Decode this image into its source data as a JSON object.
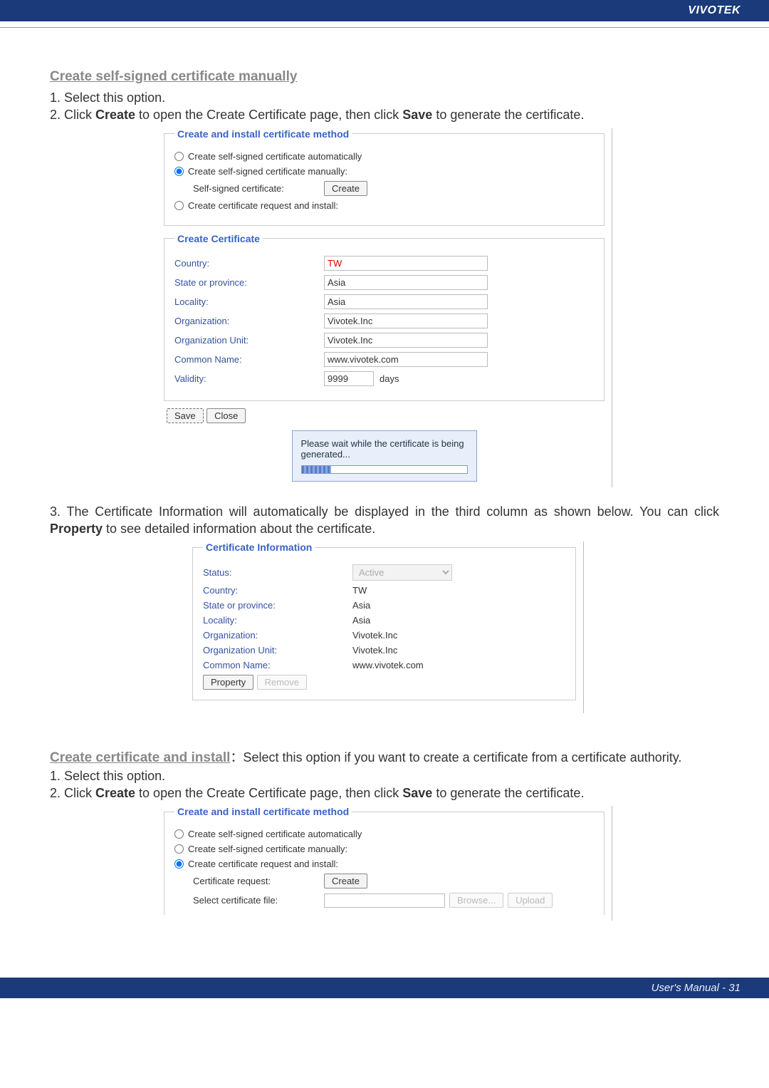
{
  "header": {
    "brand": "VIVOTEK"
  },
  "section1": {
    "heading": "Create self-signed certificate manually",
    "step1": "1. Select this option.",
    "step2_pre": "2. Click ",
    "step2_b1": "Create",
    "step2_mid": " to open the Create Certificate page, then click ",
    "step2_b2": "Save",
    "step2_post": " to generate the certificate."
  },
  "sshot1": {
    "legend": "Create and install certificate method",
    "radio_auto": "Create self-signed certificate automatically",
    "radio_manual": "Create self-signed certificate manually:",
    "self_signed_label": "Self-signed certificate:",
    "create_btn": "Create",
    "radio_request": "Create certificate request and install:",
    "cc_legend": "Create Certificate",
    "fields": {
      "country": {
        "label": "Country:",
        "value": "TW"
      },
      "state": {
        "label": "State or province:",
        "value": "Asia"
      },
      "locality": {
        "label": "Locality:",
        "value": "Asia"
      },
      "org": {
        "label": "Organization:",
        "value": "Vivotek.Inc"
      },
      "ou": {
        "label": "Organization Unit:",
        "value": "Vivotek.Inc"
      },
      "cn": {
        "label": "Common Name:",
        "value": "www.vivotek.com"
      },
      "validity": {
        "label": "Validity:",
        "value": "9999",
        "unit": "days"
      }
    },
    "save_btn": "Save",
    "close_btn": "Close",
    "toast": "Please wait while the certificate is being generated..."
  },
  "section1b": {
    "para_pre": "3. The Certificate Information will automatically be displayed in the third column as shown below. You can click ",
    "para_b": "Property",
    "para_post": " to see detailed information about the certificate."
  },
  "sshot2": {
    "legend": "Certificate Information",
    "status_label": "Status:",
    "status_value": "Active",
    "rows": {
      "country": {
        "label": "Country:",
        "value": "TW"
      },
      "state": {
        "label": "State or province:",
        "value": "Asia"
      },
      "locality": {
        "label": "Locality:",
        "value": "Asia"
      },
      "org": {
        "label": "Organization:",
        "value": "Vivotek.Inc"
      },
      "ou": {
        "label": "Organization Unit:",
        "value": "Vivotek.Inc"
      },
      "cn": {
        "label": "Common Name:",
        "value": "www.vivotek.com"
      }
    },
    "property_btn": "Property",
    "remove_btn": "Remove"
  },
  "section2": {
    "heading": "Create certificate and install",
    "desc": "：Select this option if you want to create a certificate from a certificate authority.",
    "step1": "1. Select this option.",
    "step2_pre": "2. Click ",
    "step2_b1": "Create",
    "step2_mid": " to open the Create Certificate page, then click ",
    "step2_b2": "Save",
    "step2_post": " to generate the certificate."
  },
  "sshot3": {
    "legend": "Create and install certificate method",
    "radio_auto": "Create self-signed certificate automatically",
    "radio_manual": "Create self-signed certificate manually:",
    "radio_request": "Create certificate request and install:",
    "cert_req_label": "Certificate request:",
    "create_btn": "Create",
    "select_file_label": "Select certificate file:",
    "browse_btn": "Browse...",
    "upload_btn": "Upload"
  },
  "footer": {
    "text": "User's Manual - 31"
  }
}
